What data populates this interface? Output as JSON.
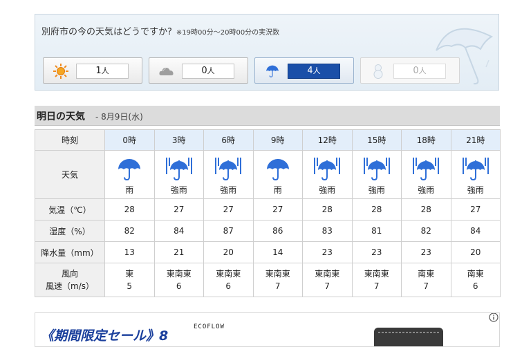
{
  "now": {
    "question": "別府市の今の天気はどうですか?",
    "note": "※19時00分～20時00分の実況数",
    "votes": [
      {
        "icon": "sun-icon",
        "count": "1",
        "unit": "人"
      },
      {
        "icon": "cloud-icon",
        "count": "0",
        "unit": "人"
      },
      {
        "icon": "umbrella-icon",
        "count": "4",
        "unit": "人",
        "selected": true
      },
      {
        "icon": "snowman-icon",
        "count": "0",
        "unit": "人",
        "disabled": true
      }
    ]
  },
  "tomorrow": {
    "title": "明日の天気",
    "date": "- 8月9日(水)",
    "labels": {
      "time": "時刻",
      "weather": "天気",
      "temp": "気温（℃）",
      "humidity": "湿度（%）",
      "precip": "降水量（mm）",
      "wind_dir": "風向",
      "wind_speed": "風速（m/s）"
    },
    "hours": [
      "0時",
      "3時",
      "6時",
      "9時",
      "12時",
      "15時",
      "18時",
      "21時"
    ],
    "weather": [
      {
        "icon": "rain-umbrella-icon",
        "text": "雨"
      },
      {
        "icon": "heavy-rain-umbrella-icon",
        "text": "強雨"
      },
      {
        "icon": "heavy-rain-umbrella-icon",
        "text": "強雨"
      },
      {
        "icon": "rain-umbrella-icon",
        "text": "雨"
      },
      {
        "icon": "heavy-rain-umbrella-icon",
        "text": "強雨"
      },
      {
        "icon": "heavy-rain-umbrella-icon",
        "text": "強雨"
      },
      {
        "icon": "heavy-rain-umbrella-icon",
        "text": "強雨"
      },
      {
        "icon": "heavy-rain-umbrella-icon",
        "text": "強雨"
      }
    ],
    "temp": [
      "28",
      "27",
      "27",
      "27",
      "28",
      "28",
      "28",
      "27"
    ],
    "humidity": [
      "82",
      "84",
      "87",
      "86",
      "83",
      "81",
      "82",
      "84"
    ],
    "precip": [
      "13",
      "21",
      "20",
      "14",
      "23",
      "23",
      "23",
      "20"
    ],
    "wind_dir": [
      "東",
      "東南東",
      "東南東",
      "東南東",
      "東南東",
      "東南東",
      "南東",
      "南東"
    ],
    "wind_speed": [
      "5",
      "6",
      "6",
      "7",
      "7",
      "7",
      "7",
      "6"
    ]
  },
  "ad": {
    "title": "《期間限定セール》8",
    "brand": "ECOFLOW"
  },
  "colors": {
    "accent": "#1a4fa8",
    "icon_blue": "#2f6fd8",
    "hour_row_bg": "#e3eefa",
    "label_bg": "#f0f0f0"
  }
}
